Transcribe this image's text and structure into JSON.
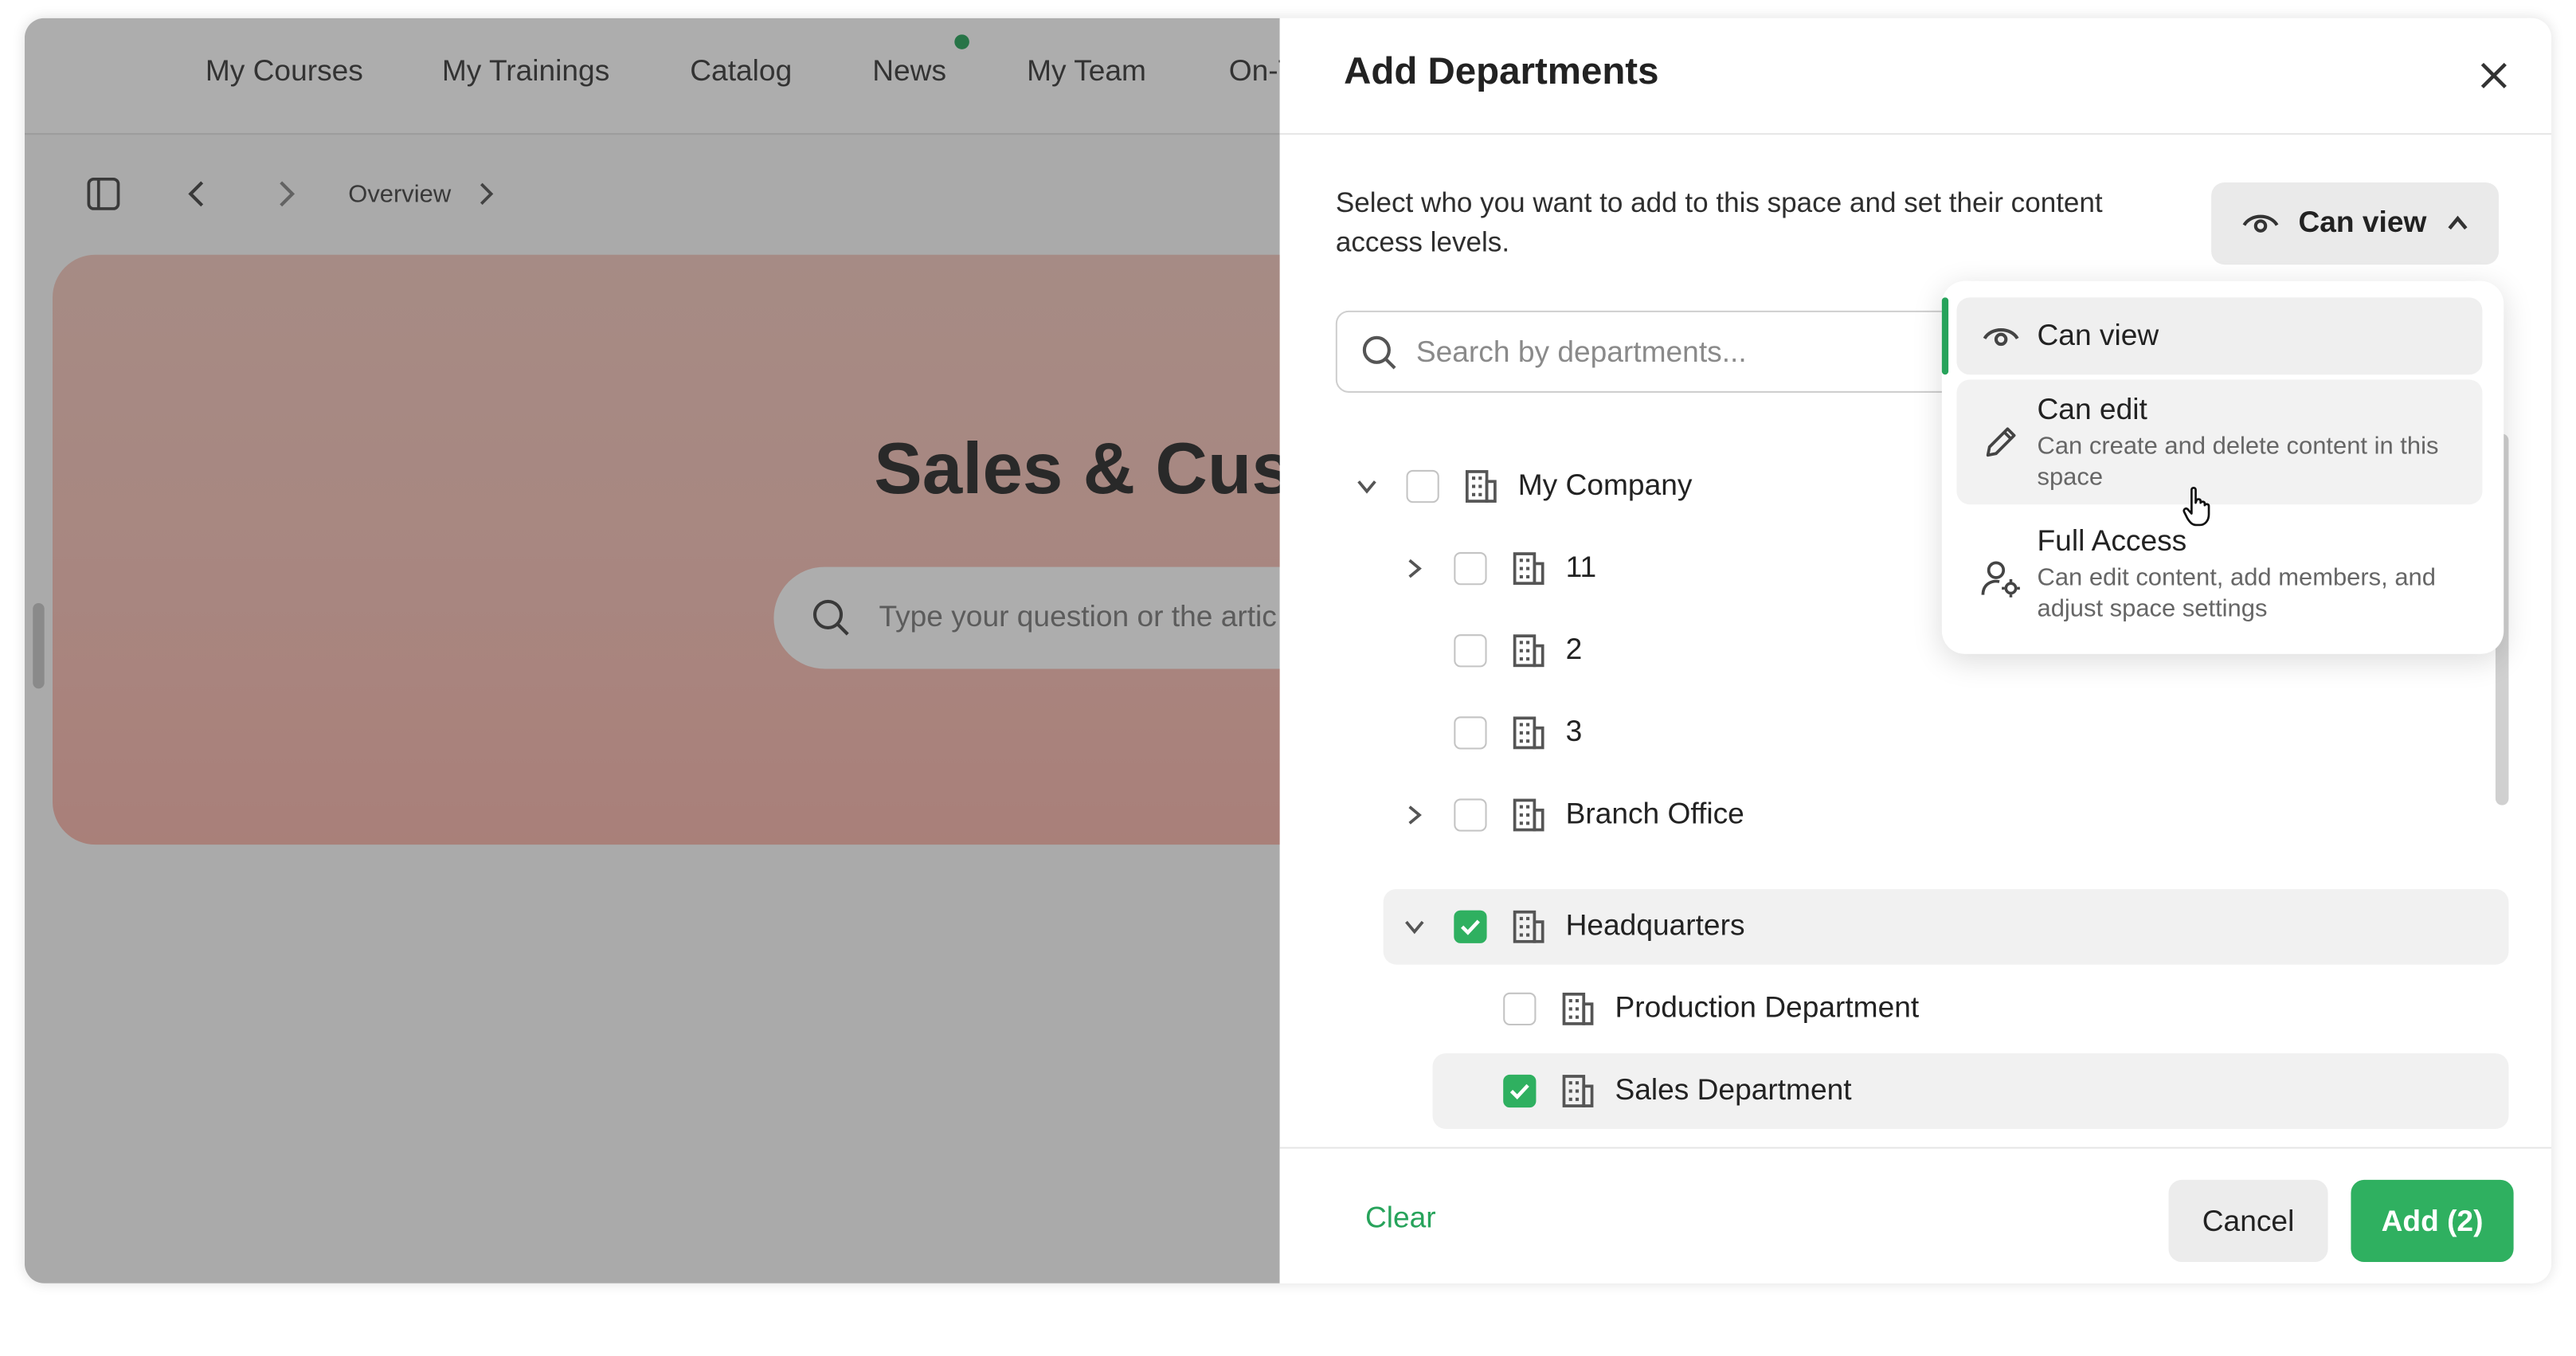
{
  "background_page": {
    "nav": [
      "My Courses",
      "My Trainings",
      "Catalog",
      "News",
      "My Team",
      "On-T"
    ],
    "breadcrumb": "Overview",
    "hero_title": "Sales & Cust",
    "hero_search_placeholder": "Type your question or the artic"
  },
  "drawer": {
    "title": "Add Departments",
    "description": "Select who you want to add to this space and set their content access levels.",
    "access_button_label": "Can view",
    "search_placeholder": "Search by departments...",
    "tree": [
      {
        "label": "My Company",
        "level": 0,
        "chevron": "down",
        "checked": false
      },
      {
        "label": "11",
        "level": 1,
        "chevron": "right",
        "checked": false
      },
      {
        "label": "2",
        "level": 1,
        "chevron": "none",
        "checked": false
      },
      {
        "label": "3",
        "level": 1,
        "chevron": "none",
        "checked": false
      },
      {
        "label": "Branch Office",
        "level": 1,
        "chevron": "right",
        "checked": false
      },
      {
        "label": "Headquarters",
        "level": 1,
        "chevron": "down",
        "checked": true
      },
      {
        "label": "Production Department",
        "level": 2,
        "chevron": "none",
        "checked": false
      },
      {
        "label": "Sales Department",
        "level": 2,
        "chevron": "none",
        "checked": true
      }
    ],
    "footer": {
      "clear": "Clear",
      "cancel": "Cancel",
      "add": "Add (2)"
    }
  },
  "dropdown": {
    "options": [
      {
        "title": "Can view",
        "description": "",
        "icon": "eye-icon",
        "state": "selected"
      },
      {
        "title": "Can edit",
        "description": "Can create and delete content in this space",
        "icon": "pencil-icon",
        "state": "hover"
      },
      {
        "title": "Full Access",
        "description": "Can edit content, add members, and adjust space settings",
        "icon": "user-gear-icon",
        "state": "none"
      }
    ]
  },
  "colors": {
    "accent_green": "#2fb060",
    "hero_pink": "#f7c2b8"
  }
}
